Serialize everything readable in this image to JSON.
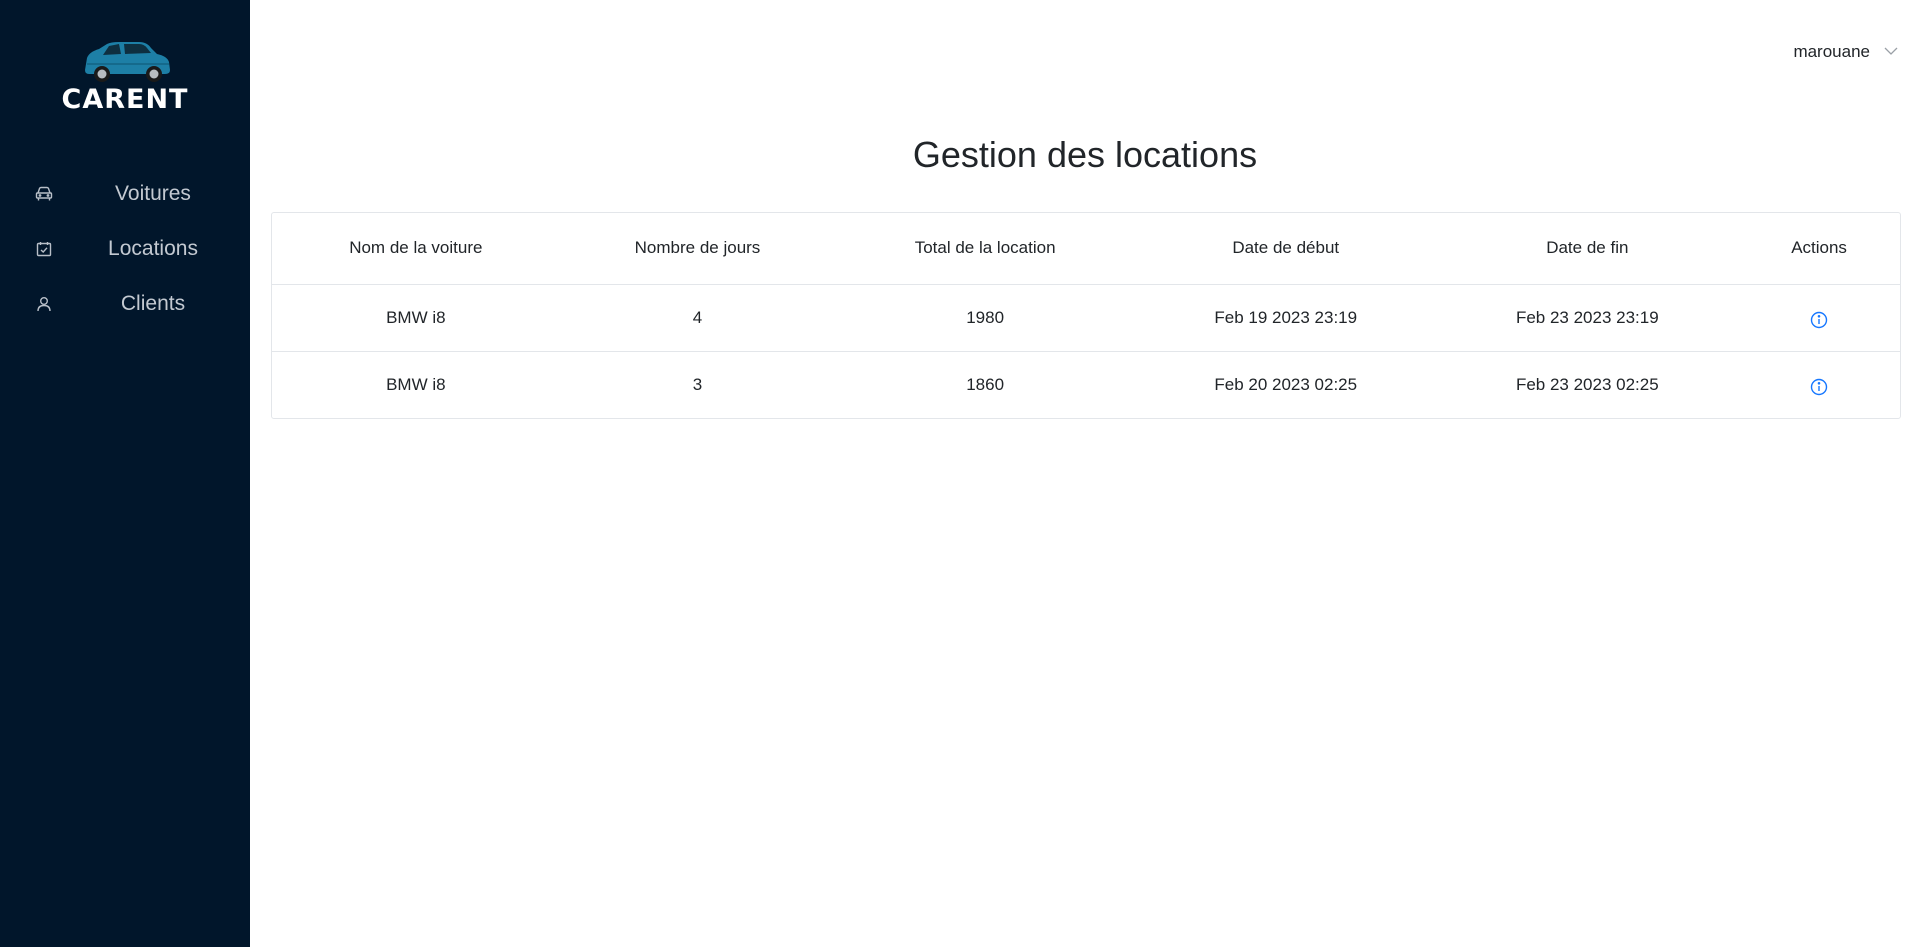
{
  "sidebar": {
    "logo_text": "CARENT",
    "items": [
      {
        "label": "Voitures",
        "icon": "car-icon"
      },
      {
        "label": "Locations",
        "icon": "calendar-check-icon"
      },
      {
        "label": "Clients",
        "icon": "user-icon"
      }
    ]
  },
  "header": {
    "user_name": "marouane",
    "user_menu_icon": "chevron-down-icon"
  },
  "main": {
    "title": "Gestion des locations",
    "table": {
      "columns": [
        "Nom de la voiture",
        "Nombre de jours",
        "Total de la location",
        "Date de début",
        "Date de fin",
        "Actions"
      ],
      "rows": [
        {
          "car": "BMW i8",
          "days": "4",
          "total": "1980",
          "start": "Feb 19 2023 23:19",
          "end": "Feb 23 2023 23:19",
          "action_icon": "info-circle-icon"
        },
        {
          "car": "BMW i8",
          "days": "3",
          "total": "1860",
          "start": "Feb 20 2023 02:25",
          "end": "Feb 23 2023 02:25",
          "action_icon": "info-circle-icon"
        }
      ]
    }
  },
  "colors": {
    "sidebar_bg": "#01162b",
    "logo_car": "#1d7fa6",
    "action_icon": "#1677ff"
  }
}
